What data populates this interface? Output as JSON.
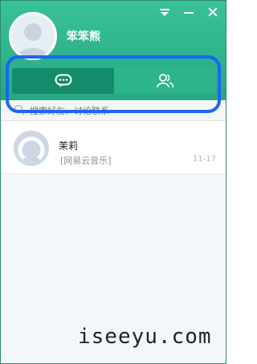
{
  "window": {
    "controls": [
      "menu-icon",
      "minimize-icon",
      "close-icon"
    ]
  },
  "profile": {
    "name": "笨笨熊"
  },
  "tabs": [
    {
      "icon": "chat-bubble-icon",
      "active": true
    },
    {
      "icon": "contacts-icon",
      "active": false
    }
  ],
  "search": {
    "placeholder": "搜索好友、讨论联系"
  },
  "conversations": [
    {
      "name": "茉莉",
      "preview": "[网易云音乐]",
      "time": "11-17"
    }
  ],
  "watermark": "iseeyu.com",
  "colors": {
    "header": "#2db38c",
    "tab_active": "#148c6c",
    "highlight_border": "#1a67f0"
  }
}
